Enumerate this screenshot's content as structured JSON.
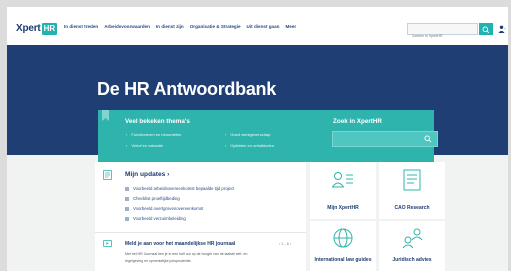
{
  "header": {
    "logo_text": "Xpert",
    "logo_badge": "HR",
    "nav": [
      "In dienst treden",
      "Arbeidsvoorwaarden",
      "In dienst zijn",
      "Organisatie & Strategie",
      "Uit dienst gaan",
      "Meer"
    ],
    "search_placeholder": "Zoeken in XpertHR"
  },
  "hero": {
    "title": "De HR Antwoordbank"
  },
  "themes": {
    "title": "Veel bekeken thema's",
    "items": [
      "Functioneren en beoordelen",
      "Goed werkgeverschap",
      "Verlof en vakantie",
      "Opleiden en ontwikkelen"
    ]
  },
  "zoek": {
    "title": "Zoek in XpertHR"
  },
  "updates": {
    "title": "Mijn updates",
    "items": [
      "Voorbeeld arbeidsovereenkomst bepaalde tijd project",
      "Checklist proeftijdbeding",
      "Voorbeeld overtgrovenovereenkomst",
      "Voorbeeld verzuimbeleiding"
    ]
  },
  "journaal": {
    "title": "Meld je aan voor het maandelijkse HR journaal",
    "pager": "‹ 1 - 6 ›",
    "text_lines": [
      "Met het HR Journaal ben je in een half uur op de hoogte van de laatste wet- en",
      "regelgeving en opmerkelijke jurisprudentie."
    ]
  },
  "tiles": [
    "Mijn XpertHR",
    "CAO Research",
    "International law guides",
    "Juridisch advies"
  ],
  "colors": {
    "navy": "#1f3f74",
    "teal": "#2fb4ad",
    "accent": "#22b3b0"
  }
}
